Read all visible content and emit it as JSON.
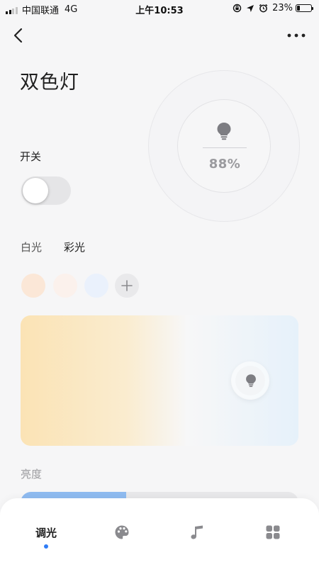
{
  "status_bar": {
    "carrier": "中国联通",
    "network": "4G",
    "time": "上午10:53",
    "battery": "23%",
    "battery_level": 0.23,
    "icons": [
      "signal-icon",
      "rotation-lock-icon",
      "location-icon",
      "alarm-icon",
      "battery-icon"
    ]
  },
  "header": {
    "back_icon": "back-chevron-icon",
    "more_icon": "more-dots-icon",
    "title": "双色灯"
  },
  "dial": {
    "icon": "bulb-icon",
    "value": "88%"
  },
  "power": {
    "label": "开关",
    "on": false
  },
  "modes": [
    {
      "label": "白光",
      "active": false
    },
    {
      "label": "彩光",
      "active": true
    }
  ],
  "presets": [
    {
      "color": "#fbe7d7"
    },
    {
      "color": "#fbf1ec"
    },
    {
      "color": "#eaf1fc"
    }
  ],
  "preset_add_icon": "plus-icon",
  "temperature": {
    "warm_color": "#fbe3b5",
    "neutral_color": "#f7f7f8",
    "cool_color": "#e6f1fa",
    "handle_icon": "bulb-icon"
  },
  "brightness": {
    "label": "亮度",
    "level": 0.38,
    "fill_color": "#8fbbf0"
  },
  "bottom_nav": {
    "items": [
      {
        "label": "调光",
        "active": true
      },
      {
        "icon": "palette-icon"
      },
      {
        "icon": "music-note-icon"
      },
      {
        "icon": "grid-icon"
      }
    ],
    "accent": "#2f7cf6"
  }
}
